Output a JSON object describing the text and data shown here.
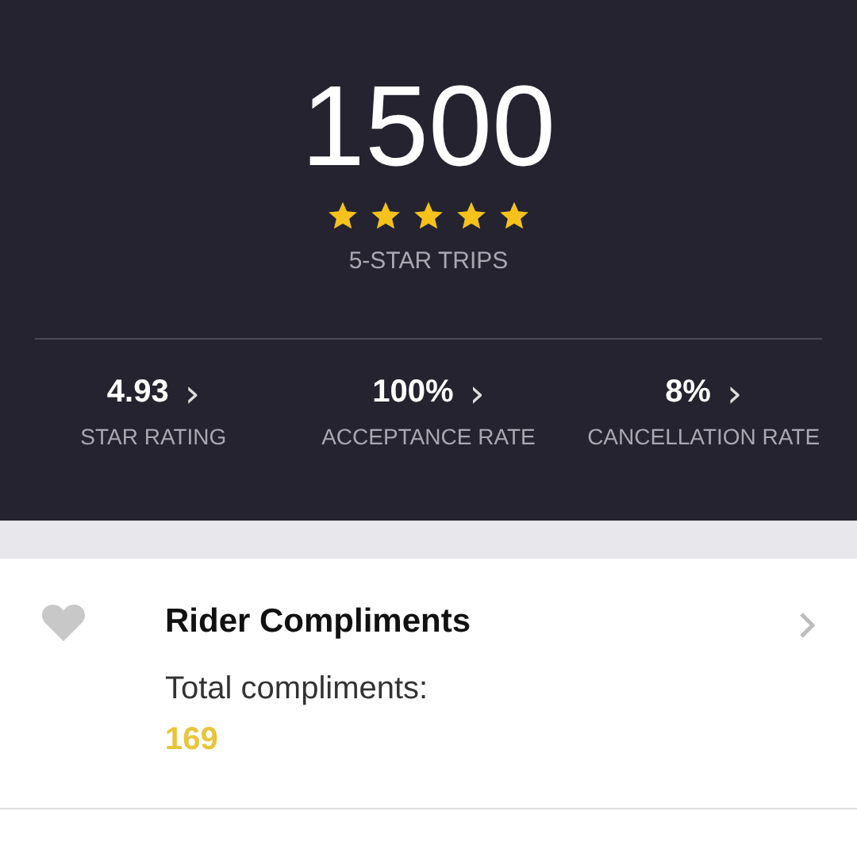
{
  "summary": {
    "trips": "1500",
    "stars": 5,
    "caption": "5-STAR TRIPS"
  },
  "stats": [
    {
      "value": "4.93",
      "chevron": "›",
      "label": "STAR RATING"
    },
    {
      "value": "100%",
      "chevron": "›",
      "label": "ACCEPTANCE RATE"
    },
    {
      "value": "8%",
      "chevron": "›",
      "label": "CANCELLATION RATE"
    }
  ],
  "compliments": {
    "title": "Rider Compliments",
    "label": "Total compliments:",
    "count": "169"
  }
}
